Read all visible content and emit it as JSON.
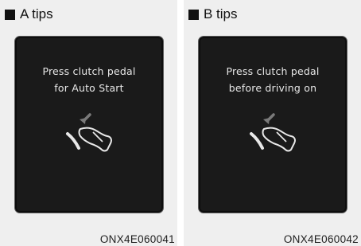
{
  "panels": [
    {
      "title": "A tips",
      "message_lines": [
        "Press clutch pedal",
        "for Auto Start"
      ],
      "icon": "clutch-pedal-icon",
      "code": "ONX4E060041"
    },
    {
      "title": "B tips",
      "message_lines": [
        "Press clutch pedal",
        "before driving on"
      ],
      "icon": "clutch-pedal-icon",
      "code": "ONX4E060042"
    }
  ],
  "colors": {
    "screen_bg": "#1a1a1a",
    "text": "#e8e8e8",
    "arrow": "#7a7a7a"
  }
}
